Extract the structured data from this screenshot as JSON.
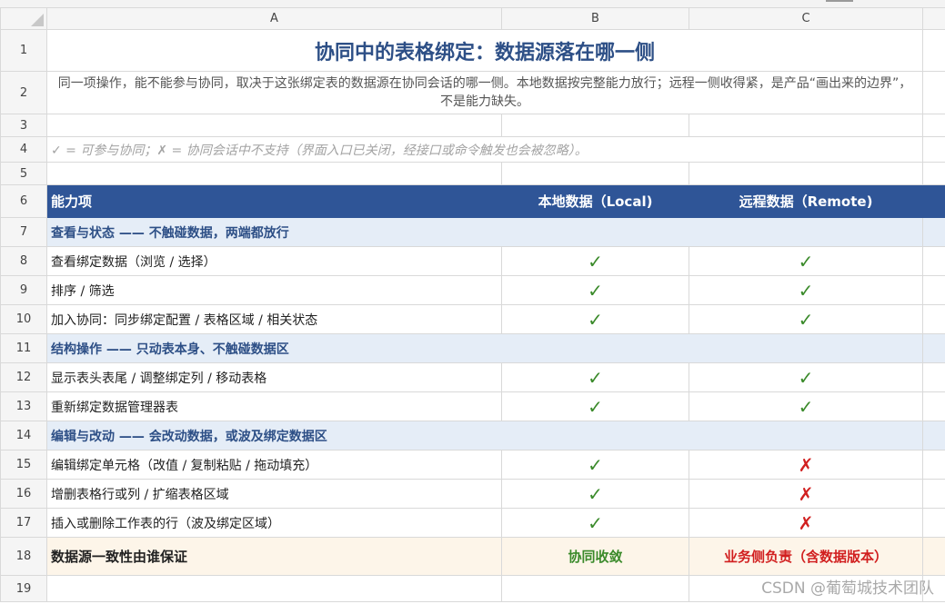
{
  "columns": {
    "a": "A",
    "b": "B",
    "c": "C"
  },
  "rows": [
    "1",
    "2",
    "3",
    "4",
    "5",
    "6",
    "7",
    "8",
    "9",
    "10",
    "11",
    "12",
    "13",
    "14",
    "15",
    "16",
    "17",
    "18",
    "19"
  ],
  "title": "协同中的表格绑定：数据源落在哪一侧",
  "intro": "同一项操作，能不能参与协同，取决于这张绑定表的数据源在协同会话的哪一侧。本地数据按完整能力放行；远程一侧收得紧，是产品“画出来的边界”，不是能力缺失。",
  "legend": "✓ = 可参与协同；✗ = 协同会话中不支持（界面入口已关闭，经接口或命令触发也会被忽略）。",
  "header": {
    "capability": "能力项",
    "local": "本地数据（Local)",
    "remote": "远程数据（Remote)"
  },
  "symbols": {
    "yes": "✓",
    "no": "✗"
  },
  "sections": [
    {
      "title": "查看与状态 —— 不触碰数据，两端都放行",
      "items": [
        {
          "label": "查看绑定数据（浏览 / 选择）",
          "local": "✓",
          "remote": "✓"
        },
        {
          "label": "排序 / 筛选",
          "local": "✓",
          "remote": "✓"
        },
        {
          "label": "加入协同：同步绑定配置 / 表格区域 / 相关状态",
          "local": "✓",
          "remote": "✓"
        }
      ]
    },
    {
      "title": "结构操作 —— 只动表本身、不触碰数据区",
      "items": [
        {
          "label": "显示表头表尾 / 调整绑定列 / 移动表格",
          "local": "✓",
          "remote": "✓"
        },
        {
          "label": "重新绑定数据管理器表",
          "local": "✓",
          "remote": "✓"
        }
      ]
    },
    {
      "title": "编辑与改动 —— 会改动数据，或波及绑定数据区",
      "items": [
        {
          "label": "编辑绑定单元格（改值 / 复制粘贴 / 拖动填充）",
          "local": "✓",
          "remote": "✗"
        },
        {
          "label": "增删表格行或列 / 扩缩表格区域",
          "local": "✓",
          "remote": "✗"
        },
        {
          "label": "插入或删除工作表的行（波及绑定区域）",
          "local": "✓",
          "remote": "✗"
        }
      ]
    }
  ],
  "ownership": {
    "label": "数据源一致性由谁保证",
    "local": "协同收敛",
    "remote": "业务侧负责（含数据版本）"
  },
  "watermark": "CSDN @葡萄城技术团队",
  "colors": {
    "header": "#2f5597",
    "section": "#e5edf7",
    "ok": "#3a8a2a",
    "no": "#d11f1f",
    "ownership_bg": "#fdf5e9"
  }
}
